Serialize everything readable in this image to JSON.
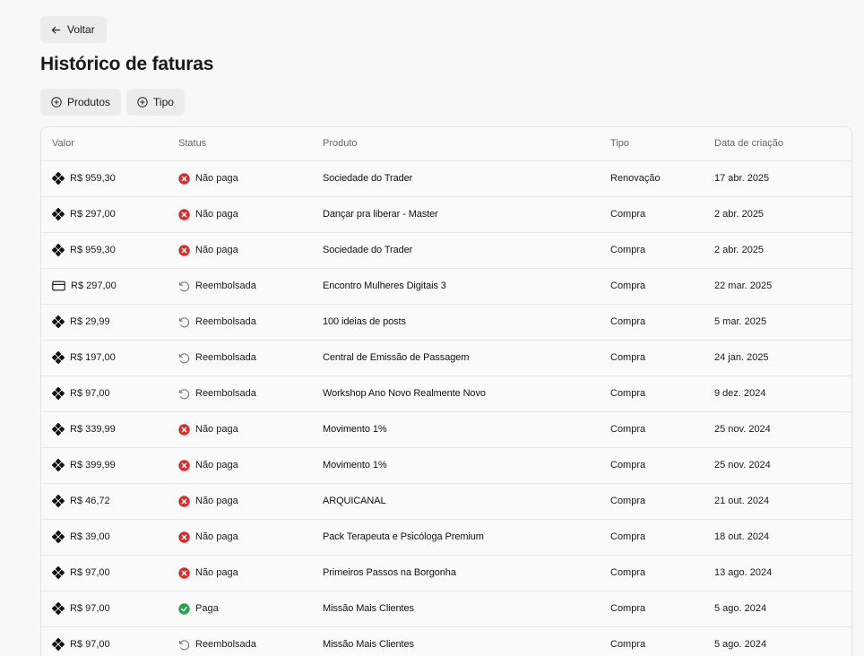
{
  "nav": {
    "back_label": "Voltar"
  },
  "page": {
    "title": "Histórico de faturas"
  },
  "filters": [
    {
      "label": "Produtos",
      "icon": "plus-circle-icon"
    },
    {
      "label": "Tipo",
      "icon": "plus-circle-icon"
    }
  ],
  "table": {
    "columns": [
      "Valor",
      "Status",
      "Produto",
      "Tipo",
      "Data de criação"
    ],
    "rows": [
      {
        "payment_icon": "pix-icon",
        "valor": "R$ 959,30",
        "status": "Não paga",
        "status_kind": "unpaid",
        "produto": "Sociedade do Trader",
        "tipo": "Renovação",
        "data": "17 abr. 2025"
      },
      {
        "payment_icon": "pix-icon",
        "valor": "R$ 297,00",
        "status": "Não paga",
        "status_kind": "unpaid",
        "produto": "Dançar pra liberar - Master",
        "tipo": "Compra",
        "data": "2 abr. 2025"
      },
      {
        "payment_icon": "pix-icon",
        "valor": "R$ 959,30",
        "status": "Não paga",
        "status_kind": "unpaid",
        "produto": "Sociedade do Trader",
        "tipo": "Compra",
        "data": "2 abr. 2025"
      },
      {
        "payment_icon": "credit-card-icon",
        "valor": "R$ 297,00",
        "status": "Reembolsada",
        "status_kind": "refunded",
        "produto": "Encontro Mulheres Digitais 3",
        "tipo": "Compra",
        "data": "22 mar. 2025"
      },
      {
        "payment_icon": "pix-icon",
        "valor": "R$ 29,99",
        "status": "Reembolsada",
        "status_kind": "refunded",
        "produto": "100 ideias de posts",
        "tipo": "Compra",
        "data": "5 mar. 2025"
      },
      {
        "payment_icon": "pix-icon",
        "valor": "R$ 197,00",
        "status": "Reembolsada",
        "status_kind": "refunded",
        "produto": "Central de Emissão de Passagem",
        "tipo": "Compra",
        "data": "24 jan. 2025"
      },
      {
        "payment_icon": "pix-icon",
        "valor": "R$ 97,00",
        "status": "Reembolsada",
        "status_kind": "refunded",
        "produto": "Workshop Ano Novo Realmente Novo",
        "tipo": "Compra",
        "data": "9 dez. 2024"
      },
      {
        "payment_icon": "pix-icon",
        "valor": "R$ 339,99",
        "status": "Não paga",
        "status_kind": "unpaid",
        "produto": "Movimento 1%",
        "tipo": "Compra",
        "data": "25 nov. 2024"
      },
      {
        "payment_icon": "pix-icon",
        "valor": "R$ 399,99",
        "status": "Não paga",
        "status_kind": "unpaid",
        "produto": "Movimento 1%",
        "tipo": "Compra",
        "data": "25 nov. 2024"
      },
      {
        "payment_icon": "pix-icon",
        "valor": "R$ 46,72",
        "status": "Não paga",
        "status_kind": "unpaid",
        "produto": "ARQUICANAL",
        "tipo": "Compra",
        "data": "21 out. 2024"
      },
      {
        "payment_icon": "pix-icon",
        "valor": "R$ 39,00",
        "status": "Não paga",
        "status_kind": "unpaid",
        "produto": "Pack Terapeuta e Psicóloga Premium",
        "tipo": "Compra",
        "data": "18 out. 2024"
      },
      {
        "payment_icon": "pix-icon",
        "valor": "R$ 97,00",
        "status": "Não paga",
        "status_kind": "unpaid",
        "produto": "Primeiros Passos na Borgonha",
        "tipo": "Compra",
        "data": "13 ago. 2024"
      },
      {
        "payment_icon": "pix-icon",
        "valor": "R$ 97,00",
        "status": "Paga",
        "status_kind": "paid",
        "produto": "Missão Mais Clientes",
        "tipo": "Compra",
        "data": "5 ago. 2024"
      },
      {
        "payment_icon": "pix-icon",
        "valor": "R$ 97,00",
        "status": "Reembolsada",
        "status_kind": "refunded",
        "produto": "Missão Mais Clientes",
        "tipo": "Compra",
        "data": "5 ago. 2024"
      }
    ]
  },
  "colors": {
    "unpaid": "#d32f2f",
    "paid": "#2e9e4f",
    "refunded": "#777777"
  }
}
